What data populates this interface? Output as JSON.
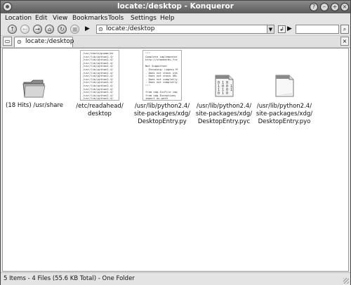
{
  "window": {
    "title": "locate:/desktop - Konqueror"
  },
  "menubar": {
    "items": [
      "Location",
      "Edit",
      "View",
      "Bookmarks",
      "Tools",
      "Settings",
      "Help"
    ]
  },
  "toolbar": {
    "location_value": "locate:/desktop",
    "search_value": ""
  },
  "tabs": [
    {
      "label": "locate:/desktop"
    }
  ],
  "items": [
    {
      "name": "(18 Hits) /usr/share",
      "type": "folder",
      "icon": "folder-icon"
    },
    {
      "name": "/etc/readahead/\ndesktop",
      "type": "text-file",
      "icon": "text-file-thumbnail-icon",
      "preview": "/usr/share/gnome/ex\n/usr/lib/python2.4/\n/usr/lib/python2.4/\n/usr/lib/python2.4/\n/usr/lib/python2.4/\n/usr/lib/python2.4/\n/usr/lib/python2.4/\n/usr/lib/python2.4/\n/usr/lib/python2.4/\n/usr/lib/python2.4/\n/usr/lib/python2.4/\n/usr/lib/python2.4/\n/usr/lib/python2.4/\n/usr/lib/python2.4/\n/usr/lib/python2.4/\n/usr/lib/python2.4/\n/usr/lib/python2.4/\n/usr/lib/python2.4/"
    },
    {
      "name": "/usr/lib/python2.4/\nsite-packages/xdg/\nDesktopEntry.py",
      "type": "python-file",
      "icon": "python-file-thumbnail-icon",
      "preview": "\"\"\"\nComplete implementat\nhttp://standards.fre\n\nNot Supported:\n- Encoding: Legacy M\n- Does not check sta\n- Does not check URL\n- Does not completly\n- Does not completly\n\"\"\"\n\nfrom xdg.IniFile imp\nfrom xdg.Exceptions\nimport os.path"
    },
    {
      "name": "/usr/lib/python2.4/\nsite-packages/xdg/\nDesktopEntry.pyc",
      "type": "binary-file",
      "icon": "binary-file-icon"
    },
    {
      "name": "/usr/lib/python2.4/\nsite-packages/xdg/\nDesktopEntry.pyo",
      "type": "generic-file",
      "icon": "generic-file-icon"
    }
  ],
  "status": {
    "text": "5 Items - 4 Files (55.6 KB Total) - One Folder"
  },
  "colors": {
    "titlebar": "#6e6e6e",
    "chrome": "#e4e4e4",
    "content_bg": "#ffffff"
  }
}
